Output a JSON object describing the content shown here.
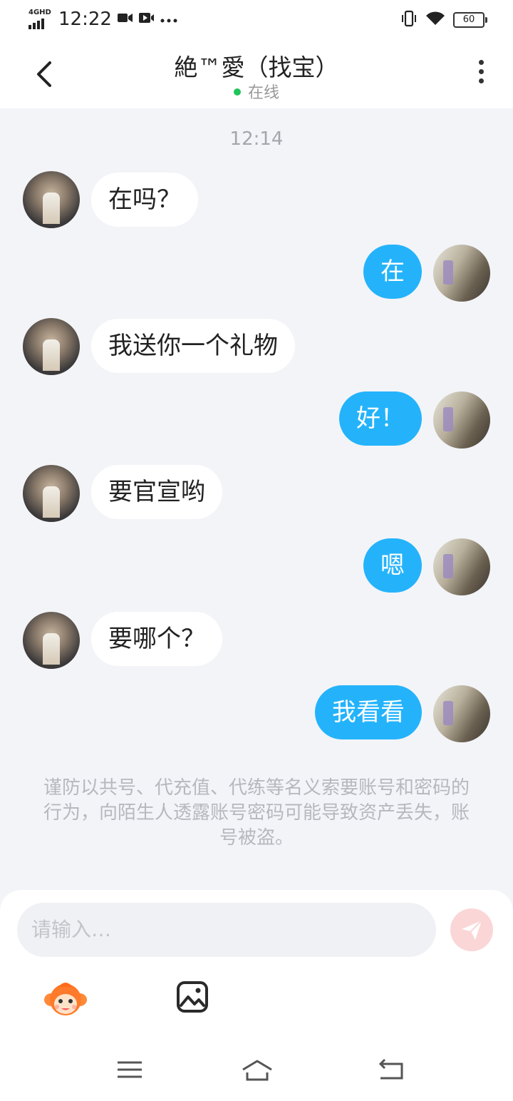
{
  "status_bar": {
    "network": "4GHD",
    "time": "12:22",
    "battery": "60",
    "icons": [
      "video-camera-icon",
      "video-play-icon",
      "more-dots-icon",
      "vibrate-icon",
      "wifi-icon",
      "battery-icon"
    ]
  },
  "header": {
    "title": "絶™愛（找宝）",
    "status_text": "在线",
    "status_color": "#21c45c"
  },
  "chat": {
    "timestamp": "12:14",
    "messages": [
      {
        "from": "other",
        "text": "在吗？"
      },
      {
        "from": "me",
        "text": "在"
      },
      {
        "from": "other",
        "text": "我送你一个礼物"
      },
      {
        "from": "me",
        "text": "好！"
      },
      {
        "from": "other",
        "text": "要官宣哟"
      },
      {
        "from": "me",
        "text": "嗯"
      },
      {
        "from": "other",
        "text": "要哪个？"
      },
      {
        "from": "me",
        "text": "我看看"
      }
    ],
    "warning": "谨防以共号、代充值、代练等名义索要账号和密码的行为，向陌生人透露账号密码可能导致资产丢失，账号被盗。"
  },
  "input": {
    "placeholder": "请输入…"
  },
  "colors": {
    "my_bubble": "#24b3fb",
    "other_bubble": "#ffffff",
    "background": "#f3f4f8",
    "send_button": "#fbd6d6"
  }
}
